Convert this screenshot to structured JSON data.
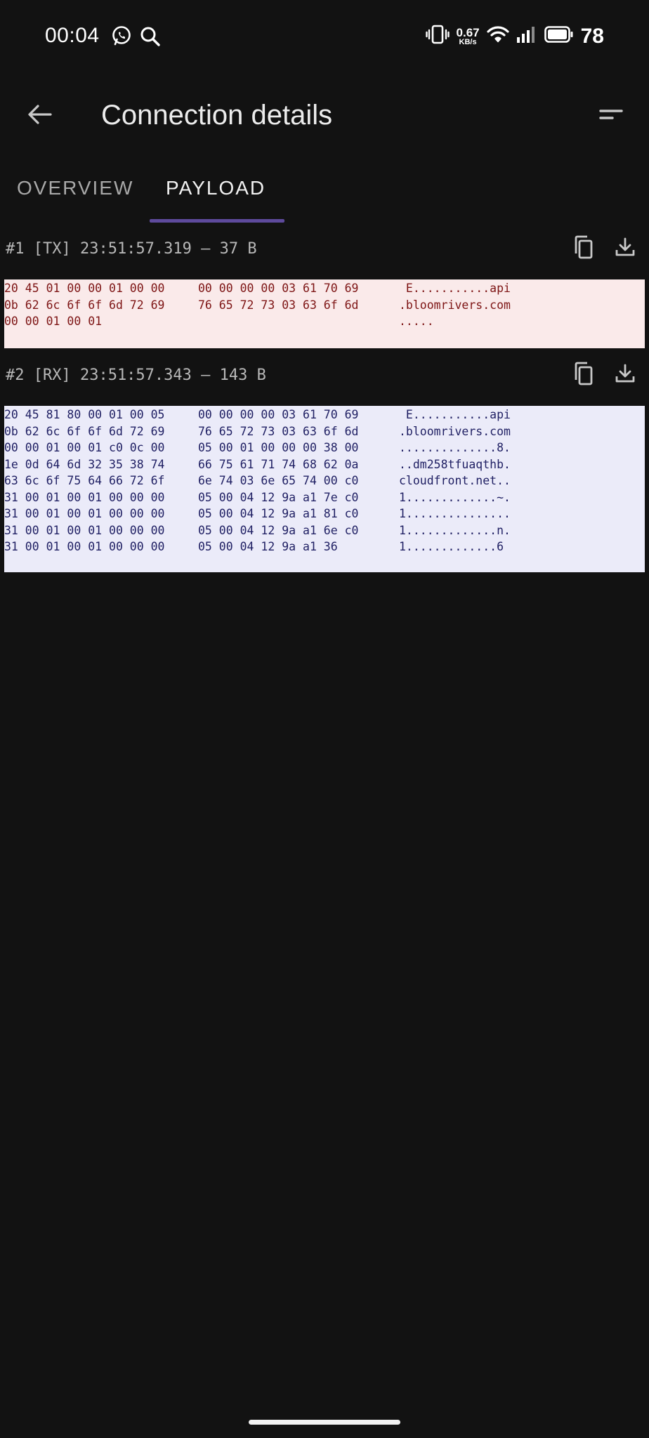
{
  "status_bar": {
    "time": "00:04",
    "net_speed_value": "0.67",
    "net_speed_unit": "KB/s",
    "battery": "78"
  },
  "app_bar": {
    "title": "Connection details"
  },
  "tabs": [
    {
      "label": "OVERVIEW",
      "selected": false
    },
    {
      "label": "PAYLOAD",
      "selected": true
    }
  ],
  "packets": [
    {
      "label": "#1 [TX] 23:51:57.319 — 37 B",
      "direction": "TX",
      "rows": [
        {
          "a": "20 45 01 00 00 01 00 00",
          "b": "00 00 00 00 03 61 70 69",
          "ascii": " E...........api"
        },
        {
          "a": "0b 62 6c 6f 6f 6d 72 69",
          "b": "76 65 72 73 03 63 6f 6d",
          "ascii": ".bloomrivers.com"
        },
        {
          "a": "00 00 01 00 01",
          "b": "",
          "ascii": "....."
        }
      ]
    },
    {
      "label": "#2 [RX] 23:51:57.343 — 143 B",
      "direction": "RX",
      "rows": [
        {
          "a": "20 45 81 80 00 01 00 05",
          "b": "00 00 00 00 03 61 70 69",
          "ascii": " E...........api"
        },
        {
          "a": "0b 62 6c 6f 6f 6d 72 69",
          "b": "76 65 72 73 03 63 6f 6d",
          "ascii": ".bloomrivers.com"
        },
        {
          "a": "00 00 01 00 01 c0 0c 00",
          "b": "05 00 01 00 00 00 38 00",
          "ascii": "..............8."
        },
        {
          "a": "1e 0d 64 6d 32 35 38 74",
          "b": "66 75 61 71 74 68 62 0a",
          "ascii": "..dm258tfuaqthb."
        },
        {
          "a": "63 6c 6f 75 64 66 72 6f",
          "b": "6e 74 03 6e 65 74 00 c0",
          "ascii": "cloudfront.net.."
        },
        {
          "a": "31 00 01 00 01 00 00 00",
          "b": "05 00 04 12 9a a1 7e c0",
          "ascii": "1.............~."
        },
        {
          "a": "31 00 01 00 01 00 00 00",
          "b": "05 00 04 12 9a a1 81 c0",
          "ascii": "1..............."
        },
        {
          "a": "31 00 01 00 01 00 00 00",
          "b": "05 00 04 12 9a a1 6e c0",
          "ascii": "1.............n."
        },
        {
          "a": "31 00 01 00 01 00 00 00",
          "b": "05 00 04 12 9a a1 36",
          "ascii": "1.............6"
        }
      ]
    }
  ],
  "colors": {
    "background": "#121212",
    "tab_indicator": "#5e4a9c",
    "tx_background": "#faeaea",
    "tx_text": "#7d1414",
    "rx_background": "#ebebf9",
    "rx_text": "#1f1f63"
  },
  "icons": {
    "status_left": [
      "whatsapp-icon",
      "search-icon"
    ],
    "status_right": [
      "vibrate-icon",
      "wifi-icon",
      "signal-icon",
      "battery-icon"
    ],
    "app_bar": [
      "back-arrow-icon",
      "sort-menu-icon"
    ],
    "packet_actions": [
      "copy-icon",
      "download-icon"
    ]
  }
}
